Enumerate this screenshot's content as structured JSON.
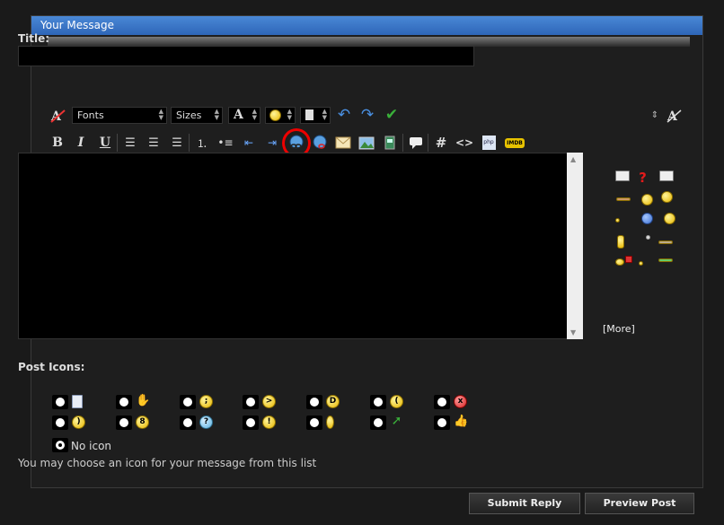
{
  "panel": {
    "header": "Your Message"
  },
  "title": {
    "label": "Title:",
    "value": ""
  },
  "toolbar1": {
    "font_select": "Fonts",
    "size_select": "Sizes",
    "font_color_icon": "A"
  },
  "toolbar2": {
    "bold": "B",
    "italic": "I",
    "underline": "U",
    "hash": "#",
    "code": "<>",
    "php": "php",
    "imdb": "IMDB"
  },
  "editor": {
    "value": ""
  },
  "smilies": {
    "more_label": "[More]"
  },
  "post_icons": {
    "label": "Post Icons:",
    "no_icon_label": "No icon",
    "hint": "You may choose an icon for your message from this list"
  },
  "buttons": {
    "submit": "Submit Reply",
    "preview": "Preview Post"
  },
  "colors": {
    "header_blue": "#3a78cc",
    "annotation_red": "#e00000",
    "check_green": "#3ab03a",
    "arrow_blue": "#4a90e2"
  }
}
